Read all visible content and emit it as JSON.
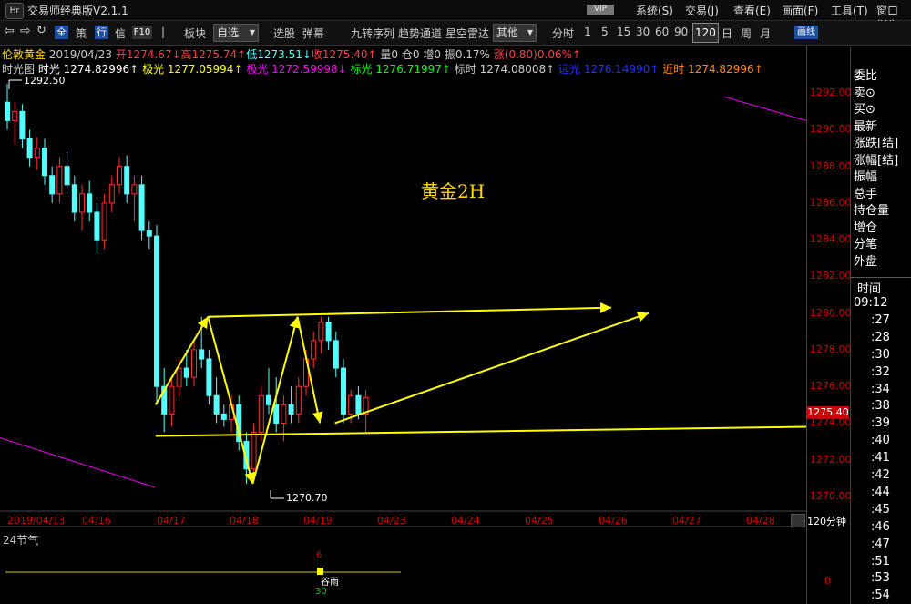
{
  "window": {
    "logo": "Hr",
    "title": "交易师经典版V2.1.1",
    "vip": "VIP",
    "menus": [
      "系统(S)",
      "交易(J)",
      "查看(E)",
      "画面(F)",
      "工具(T)",
      "窗口(W)"
    ]
  },
  "toolbar": {
    "items": [
      "全",
      "策",
      "行",
      "信",
      "F10",
      "板块",
      "自选",
      "选股",
      "弹幕",
      "九转序列",
      "趋势通道",
      "星空雷达",
      "其他",
      "分时"
    ],
    "dropdown_selected": "自选",
    "other_dropdown": "其他",
    "periods": [
      "1",
      "5",
      "15",
      "30",
      "60",
      "90",
      "120",
      "日",
      "周",
      "月"
    ],
    "selected_period": "120",
    "draw_button": "画线"
  },
  "quote": {
    "name": "伦敦黄金",
    "date": "2019/04/23",
    "open": "开1274.67↓",
    "high": "高1275.74↑",
    "low": "低1273.51↓",
    "close": "收1275.40↑",
    "volume": "量0",
    "position": "仓0",
    "increase": "增0",
    "amplitude": "振0.17%",
    "change": "涨(0.80)0.06%↑"
  },
  "indicators": {
    "main_label": "时光图",
    "shiguang": "时光 1274.82996↑",
    "jiguang": "极光 1277.05994↑",
    "jiguang2": "极光 1272.59998↓",
    "biaoguang": "标光 1276.71997↑",
    "biaoshi": "标时 1274.08008↑",
    "yuanguang": "远光 1276.14990↑",
    "jinshi": "近时 1274.82996↑"
  },
  "chart": {
    "annotation": "黄金2H",
    "high_label": "1292.50",
    "low_label": "1270.70",
    "period_label": "120分钟",
    "current_price": "1275.40",
    "colors": {
      "up": "#ff3030",
      "down": "#54ffff",
      "trend": "#ffff00",
      "axis": "#cc0000",
      "ma": "#cc00cc"
    }
  },
  "chart_data": {
    "type": "candlestick",
    "title": "黄金2H",
    "y_ticks": [
      "1292.00",
      "1290.00",
      "1288.00",
      "1286.00",
      "1284.00",
      "1282.00",
      "1280.00",
      "1278.00",
      "1276.00",
      "1274.00",
      "1272.00",
      "1270.00"
    ],
    "x_ticks": [
      "2019/04/13",
      "04/16",
      "04/17",
      "04/18",
      "04/19",
      "04/23",
      "04/24",
      "04/25",
      "04/26",
      "04/27",
      "04/28"
    ],
    "ylim": [
      1269.5,
      1293.5
    ],
    "annotations": [
      "1292.50",
      "1270.70"
    ],
    "candles": [
      {
        "o": 1291.5,
        "h": 1292.5,
        "l": 1290.0,
        "c": 1290.5
      },
      {
        "o": 1290.5,
        "h": 1291.5,
        "l": 1289.2,
        "c": 1291.0
      },
      {
        "o": 1291.0,
        "h": 1291.4,
        "l": 1289.0,
        "c": 1289.5
      },
      {
        "o": 1289.5,
        "h": 1290.0,
        "l": 1288.0,
        "c": 1288.5
      },
      {
        "o": 1288.5,
        "h": 1289.6,
        "l": 1287.8,
        "c": 1289.0
      },
      {
        "o": 1289.0,
        "h": 1289.5,
        "l": 1287.0,
        "c": 1287.5
      },
      {
        "o": 1287.5,
        "h": 1288.0,
        "l": 1286.0,
        "c": 1286.5
      },
      {
        "o": 1286.5,
        "h": 1288.5,
        "l": 1286.0,
        "c": 1288.0
      },
      {
        "o": 1288.0,
        "h": 1288.8,
        "l": 1286.5,
        "c": 1287.0
      },
      {
        "o": 1287.0,
        "h": 1287.5,
        "l": 1285.0,
        "c": 1285.5
      },
      {
        "o": 1285.5,
        "h": 1287.0,
        "l": 1284.5,
        "c": 1286.5
      },
      {
        "o": 1286.5,
        "h": 1287.2,
        "l": 1285.0,
        "c": 1285.5
      },
      {
        "o": 1285.5,
        "h": 1286.0,
        "l": 1283.2,
        "c": 1284.0
      },
      {
        "o": 1284.0,
        "h": 1286.5,
        "l": 1283.5,
        "c": 1286.0
      },
      {
        "o": 1286.0,
        "h": 1287.5,
        "l": 1285.5,
        "c": 1287.0
      },
      {
        "o": 1287.0,
        "h": 1288.5,
        "l": 1286.5,
        "c": 1288.0
      },
      {
        "o": 1288.0,
        "h": 1288.6,
        "l": 1286.0,
        "c": 1286.5
      },
      {
        "o": 1286.5,
        "h": 1287.5,
        "l": 1285.0,
        "c": 1287.0
      },
      {
        "o": 1287.0,
        "h": 1287.5,
        "l": 1284.0,
        "c": 1284.5
      },
      {
        "o": 1284.5,
        "h": 1285.0,
        "l": 1283.5,
        "c": 1284.2
      },
      {
        "o": 1284.2,
        "h": 1284.8,
        "l": 1275.0,
        "c": 1276.0
      },
      {
        "o": 1276.0,
        "h": 1277.0,
        "l": 1273.5,
        "c": 1274.5
      },
      {
        "o": 1274.5,
        "h": 1276.5,
        "l": 1273.8,
        "c": 1276.0
      },
      {
        "o": 1276.0,
        "h": 1277.5,
        "l": 1275.5,
        "c": 1277.0
      },
      {
        "o": 1277.0,
        "h": 1278.0,
        "l": 1276.0,
        "c": 1276.5
      },
      {
        "o": 1276.5,
        "h": 1278.5,
        "l": 1276.0,
        "c": 1278.0
      },
      {
        "o": 1278.0,
        "h": 1279.8,
        "l": 1277.0,
        "c": 1277.5
      },
      {
        "o": 1277.5,
        "h": 1278.0,
        "l": 1275.0,
        "c": 1275.5
      },
      {
        "o": 1275.5,
        "h": 1276.5,
        "l": 1274.0,
        "c": 1274.5
      },
      {
        "o": 1274.5,
        "h": 1275.0,
        "l": 1273.8,
        "c": 1274.2
      },
      {
        "o": 1274.2,
        "h": 1275.5,
        "l": 1273.5,
        "c": 1275.0
      },
      {
        "o": 1275.0,
        "h": 1275.5,
        "l": 1272.5,
        "c": 1273.0
      },
      {
        "o": 1273.0,
        "h": 1273.5,
        "l": 1270.7,
        "c": 1271.5
      },
      {
        "o": 1271.5,
        "h": 1274.0,
        "l": 1271.0,
        "c": 1273.5
      },
      {
        "o": 1273.5,
        "h": 1276.0,
        "l": 1273.0,
        "c": 1275.5
      },
      {
        "o": 1275.5,
        "h": 1277.0,
        "l": 1274.5,
        "c": 1275.0
      },
      {
        "o": 1275.0,
        "h": 1276.5,
        "l": 1273.5,
        "c": 1274.0
      },
      {
        "o": 1274.0,
        "h": 1275.5,
        "l": 1273.0,
        "c": 1275.0
      },
      {
        "o": 1275.0,
        "h": 1276.0,
        "l": 1274.0,
        "c": 1274.5
      },
      {
        "o": 1274.5,
        "h": 1276.5,
        "l": 1274.0,
        "c": 1276.0
      },
      {
        "o": 1276.0,
        "h": 1278.0,
        "l": 1275.5,
        "c": 1277.5
      },
      {
        "o": 1277.5,
        "h": 1279.0,
        "l": 1277.0,
        "c": 1278.5
      },
      {
        "o": 1278.5,
        "h": 1279.8,
        "l": 1277.8,
        "c": 1279.5
      },
      {
        "o": 1279.5,
        "h": 1279.8,
        "l": 1278.0,
        "c": 1278.5
      },
      {
        "o": 1278.5,
        "h": 1279.0,
        "l": 1276.5,
        "c": 1277.0
      },
      {
        "o": 1277.0,
        "h": 1277.5,
        "l": 1274.0,
        "c": 1274.5
      },
      {
        "o": 1274.5,
        "h": 1275.8,
        "l": 1274.0,
        "c": 1275.5
      },
      {
        "o": 1275.5,
        "h": 1276.0,
        "l": 1274.2,
        "c": 1274.5
      },
      {
        "o": 1274.5,
        "h": 1275.8,
        "l": 1273.5,
        "c": 1275.4
      }
    ],
    "trend_lines": [
      {
        "from": [
          4,
          1273.3
        ],
        "to": [
          127,
          1274.0
        ],
        "arrow": true
      },
      {
        "from": [
          11,
          1279.8
        ],
        "to": [
          65,
          1280.3
        ],
        "arrow": true
      },
      {
        "from": [
          4,
          1275.0
        ],
        "to": [
          11,
          1279.8
        ],
        "arrow": true
      },
      {
        "from": [
          11,
          1279.8
        ],
        "to": [
          17,
          1270.7
        ],
        "arrow": true
      },
      {
        "from": [
          17,
          1270.7
        ],
        "to": [
          23,
          1279.8
        ],
        "arrow": true
      },
      {
        "from": [
          23,
          1279.8
        ],
        "to": [
          26,
          1274.0
        ],
        "arrow": true
      },
      {
        "from": [
          28,
          1274.0
        ],
        "to": [
          70,
          1280.0
        ],
        "arrow": true
      }
    ],
    "ma_lines": [
      {
        "from": [
          0,
          1273.2
        ],
        "to": [
          20,
          1270.5
        ]
      },
      {
        "from": [
          100,
          1291.8
        ],
        "to": [
          127,
          1290.5
        ]
      }
    ]
  },
  "sub_chart": {
    "title": "24节气",
    "marker_top": "6",
    "marker_label": "谷雨",
    "marker_bottom": "30",
    "axis_zero": "0"
  },
  "right_panel": {
    "items": [
      "委比",
      "卖⊙",
      "买⊙",
      "最新",
      "涨跌[结]",
      "涨幅[结]",
      "振幅",
      "总手",
      "持仓量",
      "增仓",
      "分笔",
      "外盘"
    ],
    "time_header": "时间",
    "times": [
      "09:12",
      ":27",
      ":28",
      ":30",
      ":32",
      ":34",
      ":38",
      ":39",
      ":40",
      ":41",
      ":42",
      ":44",
      ":45",
      ":46",
      ":47",
      ":51",
      ":53",
      ":54"
    ]
  }
}
